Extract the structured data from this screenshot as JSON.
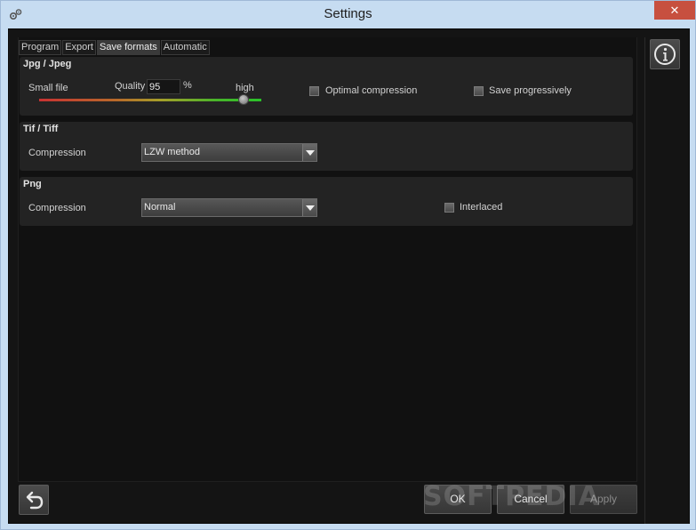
{
  "window": {
    "title": "Settings",
    "close_glyph": "✕"
  },
  "tabs": [
    {
      "label": "Program",
      "active": false
    },
    {
      "label": "Export",
      "active": false
    },
    {
      "label": "Save formats",
      "active": true
    },
    {
      "label": "Automatic",
      "active": false
    }
  ],
  "jpeg": {
    "title": "Jpg / Jpeg",
    "small_label": "Small file",
    "quality_label": "Quality",
    "quality_value": "95",
    "percent": "%",
    "high_label": "high",
    "slider_fraction": 0.92,
    "optimal_label": "Optimal compression",
    "optimal_checked": false,
    "progressive_label": "Save progressively",
    "progressive_checked": false
  },
  "tiff": {
    "title": "Tif / Tiff",
    "compression_label": "Compression",
    "compression_value": "LZW method"
  },
  "png": {
    "title": "Png",
    "compression_label": "Compression",
    "compression_value": "Normal",
    "interlaced_label": "Interlaced",
    "interlaced_checked": false
  },
  "buttons": {
    "ok": "OK",
    "cancel": "Cancel",
    "apply": "Apply"
  },
  "watermark": "SOFTPEDIA",
  "icons": {
    "app": "gears-icon",
    "info": "info-icon",
    "back": "undo-arrow-icon",
    "close": "close-icon"
  }
}
